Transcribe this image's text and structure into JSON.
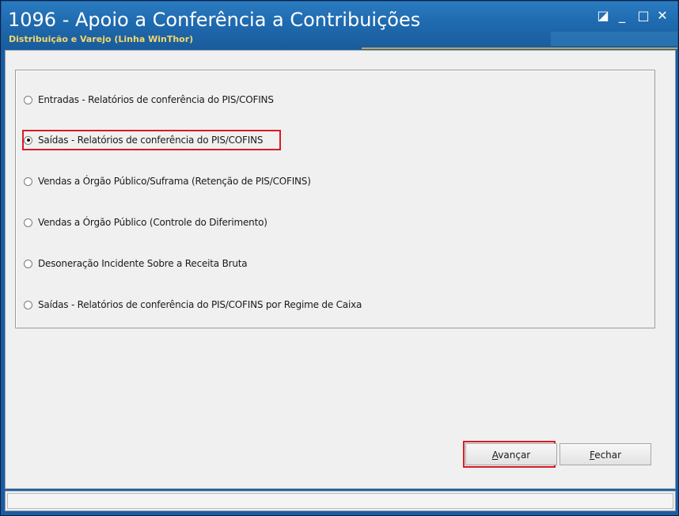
{
  "window": {
    "title": "1096 - Apoio a Conferência a Contribuições",
    "subtitle": "Distribuição e Varejo (Linha WinThor)",
    "controls": {
      "restore": "◪",
      "minimize": "_",
      "maximize": "□",
      "close": "✕"
    }
  },
  "options": [
    {
      "label": "Entradas - Relatórios de conferência do PIS/COFINS",
      "checked": false
    },
    {
      "label": "Saídas - Relatórios de conferência do PIS/COFINS",
      "checked": true
    },
    {
      "label": "Vendas a Órgão Público/Suframa (Retenção de PIS/COFINS)",
      "checked": false
    },
    {
      "label": "Vendas a Órgão Público (Controle do Diferimento)",
      "checked": false
    },
    {
      "label": "Desoneração Incidente Sobre a Receita Bruta",
      "checked": false
    },
    {
      "label": "Saídas - Relatórios de conferência do PIS/COFINS por Regime de Caixa",
      "checked": false
    }
  ],
  "buttons": {
    "next": "Avançar",
    "close": "Fechar"
  },
  "colors": {
    "titlebar": "#1f6aaf",
    "subtitle": "#f3d76a",
    "highlight": "#d91b24"
  }
}
